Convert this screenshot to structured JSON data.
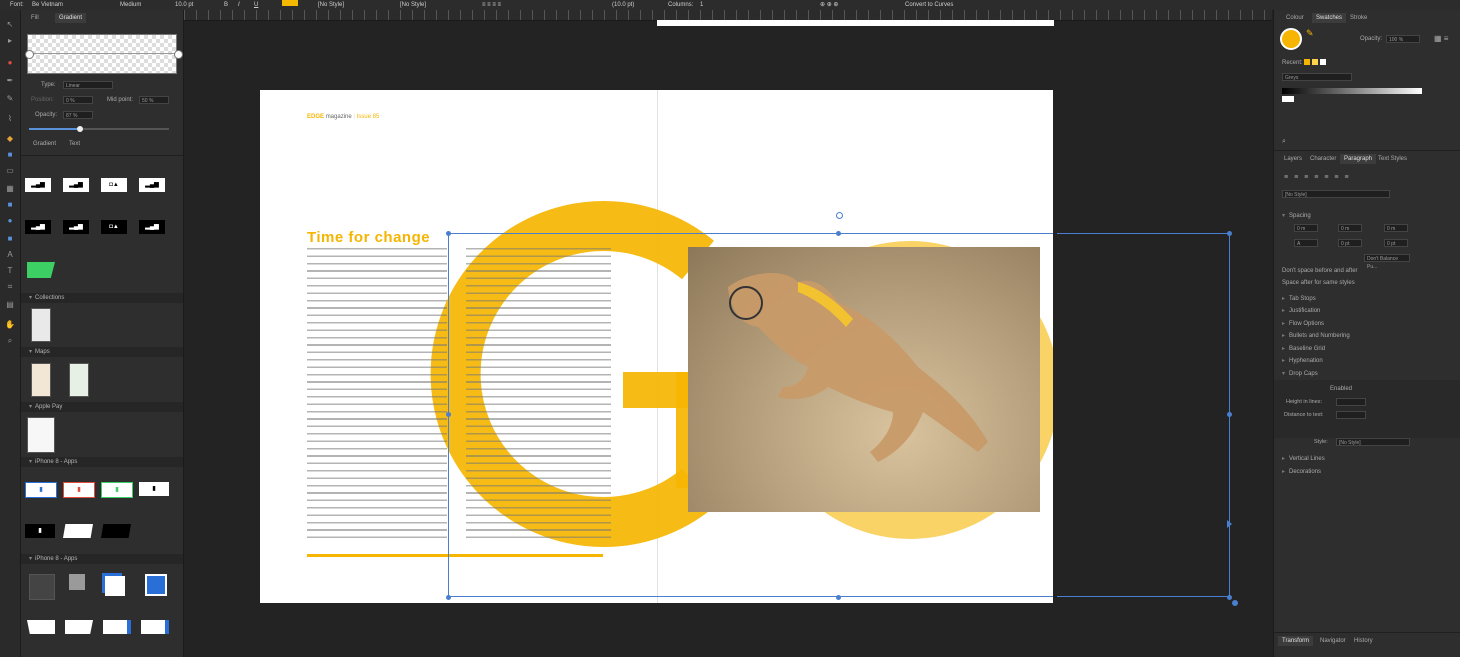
{
  "topbar": {
    "font_label": "Font:",
    "font_value": "Be Vietnam",
    "weight": "Medium",
    "size": "10.0 pt",
    "style_para": "[No Style]",
    "style_char": "[No Style]",
    "columns_label": "Columns:",
    "columns_value": "1",
    "convert_label": "Convert to Curves"
  },
  "left_panel": {
    "tabs": [
      "Fill",
      "Gradient"
    ],
    "type_label": "Type:",
    "type_value": "Linear",
    "position_label": "Position:",
    "position_value": "0 %",
    "midpoint_label": "Mid point:",
    "midpoint_value": "50 %",
    "opacity_label": "Opacity:",
    "opacity_value": "87 %",
    "sub_tabs": [
      "Gradient",
      "Text"
    ],
    "sections": [
      {
        "title": "Collections"
      },
      {
        "title": "Maps"
      },
      {
        "title": "Apple Pay"
      },
      {
        "title": "iPhone 8 - Apps"
      },
      {
        "title": "iPhone 8 - Apps"
      }
    ]
  },
  "document": {
    "brand": "EDGE",
    "brand_rest": "magazine",
    "issue": "Issue 85",
    "headline": "Time for change",
    "big_letters": "GO"
  },
  "right_panel": {
    "top_tabs": [
      "Colour",
      "Swatches",
      "Stroke"
    ],
    "opacity_label": "Opacity:",
    "opacity_value": "100 %",
    "recent_label": "Recent:",
    "palette_value": "Greys",
    "para_tabs": [
      "Layers",
      "Character",
      "Paragraph",
      "Text Styles"
    ],
    "no_style": "[No Style]",
    "spacing_title": "Spacing",
    "options": [
      "Don't Balance Pu...",
      "Don't space before and after",
      "Space after for same styles"
    ],
    "sections": [
      "Tab Stops",
      "Justification",
      "Flow Options",
      "Bullets and Numbering",
      "Baseline Grid",
      "Hyphenation",
      "Drop Caps"
    ],
    "dropcaps": {
      "enabled_label": "Enabled",
      "height_label": "Height in lines:",
      "distance_label": "Distance to text:",
      "style_label": "Style:",
      "style_value": "[No Style]"
    },
    "sections2": [
      "Vertical Lines",
      "Decorations"
    ],
    "bottom_tabs": [
      "Transform",
      "Navigator",
      "History"
    ]
  }
}
